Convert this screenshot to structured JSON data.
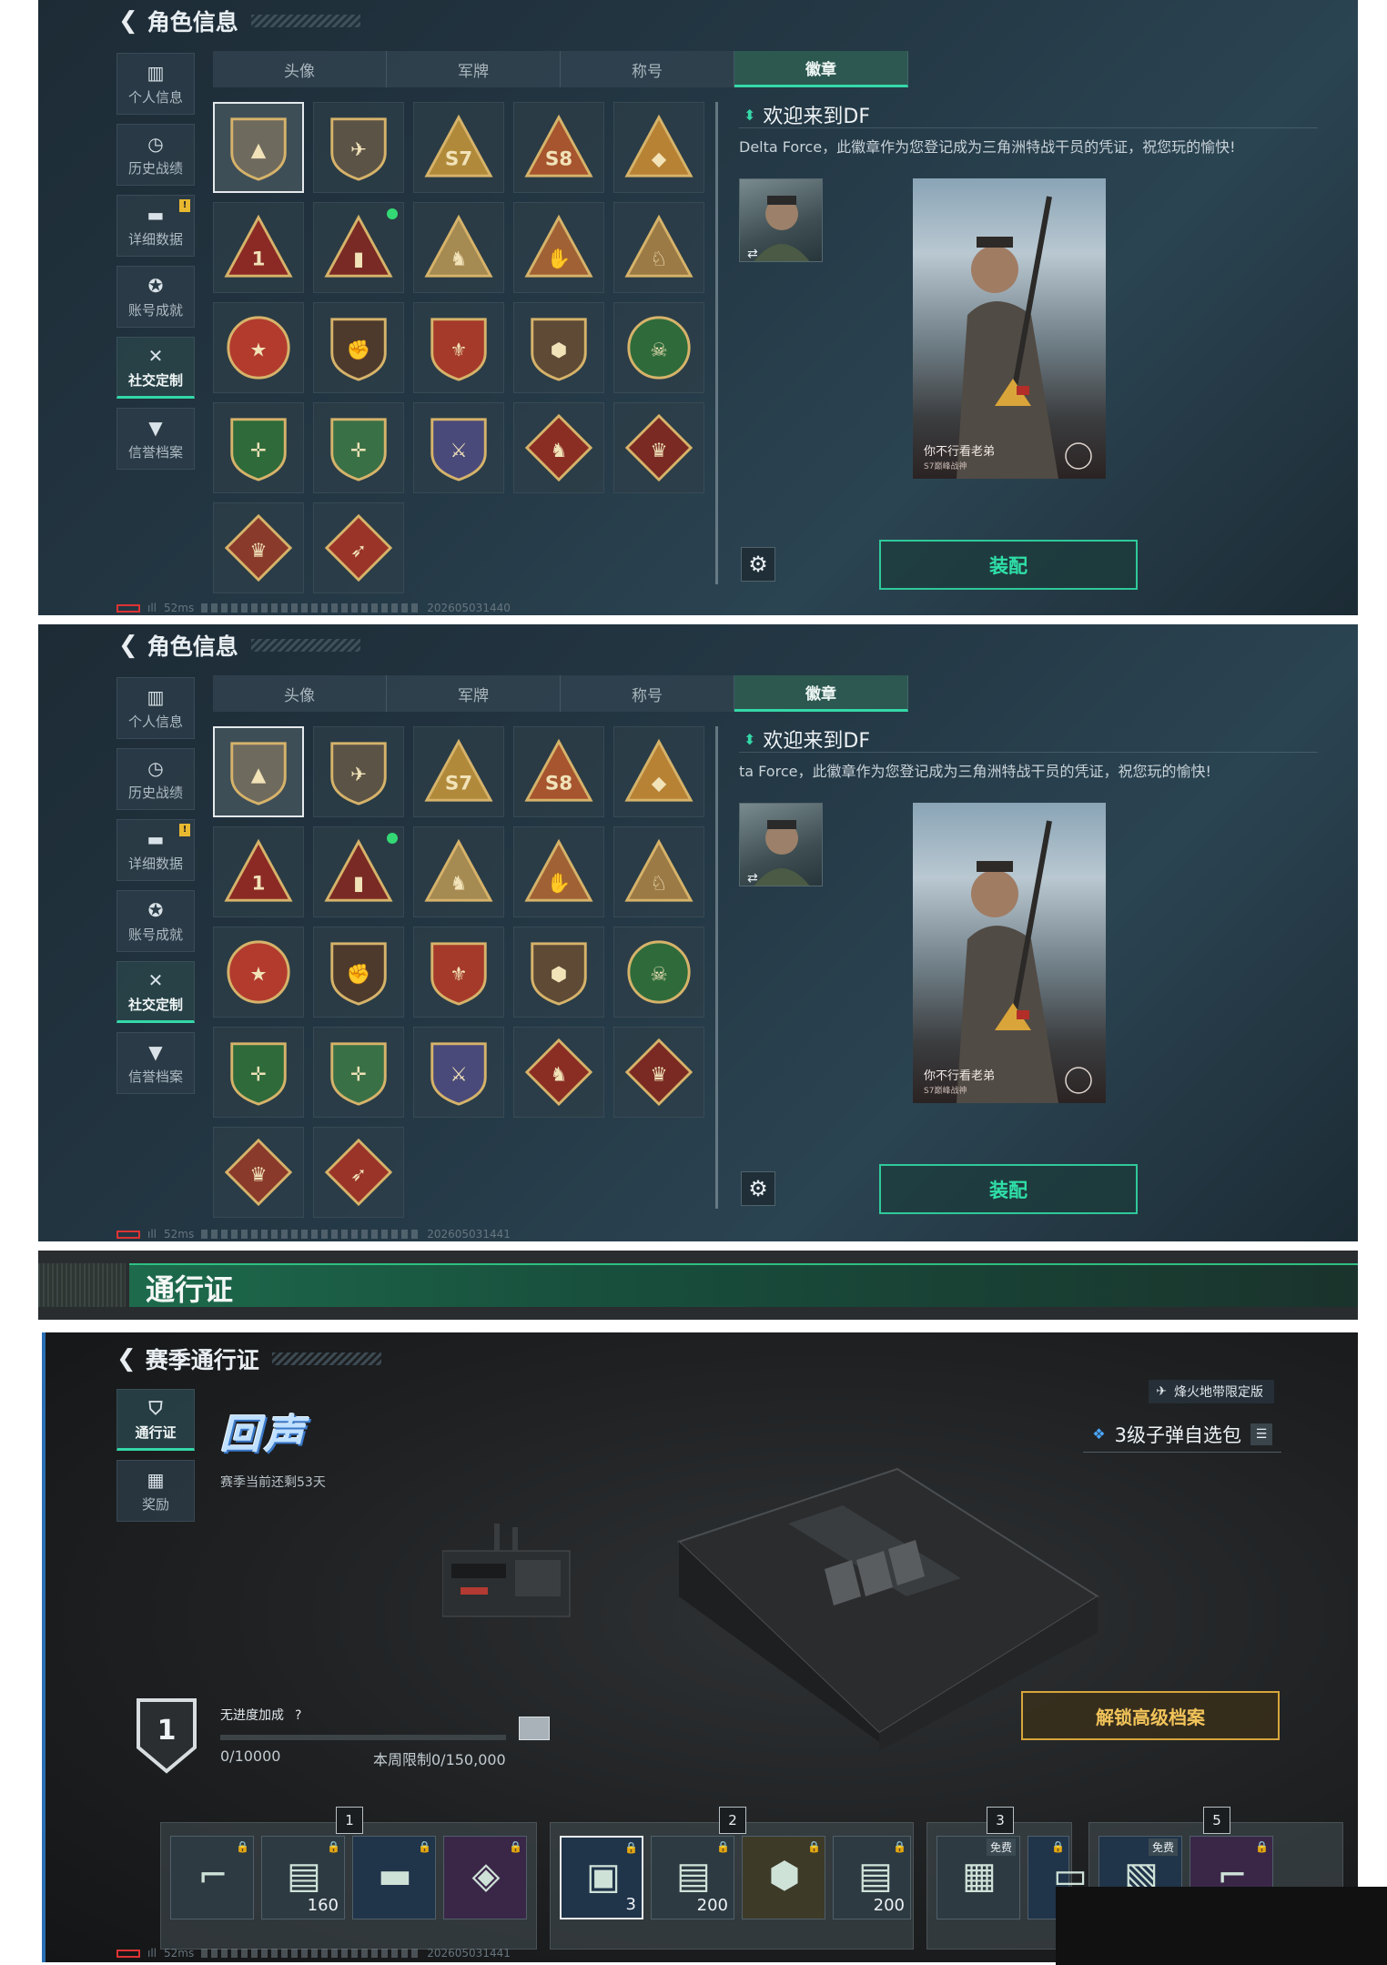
{
  "role_panels": [
    {
      "title": "角色信息",
      "sidebar": [
        {
          "label": "个人信息",
          "icon": "chart-icon"
        },
        {
          "label": "历史战绩",
          "icon": "clock-icon"
        },
        {
          "label": "详细数据",
          "icon": "folder-icon",
          "notice": "!"
        },
        {
          "label": "账号成就",
          "icon": "medal-icon"
        },
        {
          "label": "社交定制",
          "icon": "tools-icon",
          "active": true
        },
        {
          "label": "信誉档案",
          "icon": "shield-icon"
        }
      ],
      "tabs": [
        "头像",
        "军牌",
        "称号",
        "徽章"
      ],
      "active_tab": "徽章",
      "detail_title": "欢迎来到DF",
      "detail_desc": "Delta Force，此徽章作为您登记成为三角洲特战干员的凭证，祝您玩的愉快!",
      "card_name": "你不行看老弟",
      "card_sub": "S7巅峰战神",
      "equip_label": "装配",
      "status_ping": "52ms",
      "status_code": "202605031440"
    },
    {
      "title": "角色信息",
      "sidebar": [
        {
          "label": "个人信息",
          "icon": "chart-icon"
        },
        {
          "label": "历史战绩",
          "icon": "clock-icon"
        },
        {
          "label": "详细数据",
          "icon": "folder-icon",
          "notice": "!"
        },
        {
          "label": "账号成就",
          "icon": "medal-icon"
        },
        {
          "label": "社交定制",
          "icon": "tools-icon",
          "active": true
        },
        {
          "label": "信誉档案",
          "icon": "shield-icon"
        }
      ],
      "tabs": [
        "头像",
        "军牌",
        "称号",
        "徽章"
      ],
      "active_tab": "徽章",
      "detail_title": "欢迎来到DF",
      "detail_desc": "ta Force，此徽章作为您登记成为三角洲特战干员的凭证，祝您玩的愉快!",
      "card_name": "你不行看老弟",
      "card_sub": "S7巅峰战神",
      "equip_label": "装配",
      "status_ping": "52ms",
      "status_code": "202605031441"
    }
  ],
  "badges": [
    {
      "name": "delta-badge",
      "shape": "shield",
      "color": "#6f6a5e",
      "mark": "▲",
      "selected": true
    },
    {
      "name": "helicopter-badge",
      "shape": "shield",
      "color": "#5b5346",
      "mark": "✈"
    },
    {
      "name": "s7-badge",
      "shape": "triangle",
      "color": "#b08a3a",
      "mark": "S7"
    },
    {
      "name": "s8-badge",
      "shape": "triangle",
      "color": "#a6552e",
      "mark": "S8"
    },
    {
      "name": "wings-badge",
      "shape": "triangle",
      "color": "#b88234",
      "mark": "◆"
    },
    {
      "name": "rank1-badge",
      "shape": "triangle",
      "color": "#8b2a25",
      "mark": "1"
    },
    {
      "name": "crate-badge",
      "shape": "triangle",
      "color": "#7a2a24",
      "mark": "▮",
      "dot": true
    },
    {
      "name": "soldier-badge",
      "shape": "triangle",
      "color": "#a58a52",
      "mark": "♞"
    },
    {
      "name": "hand-badge",
      "shape": "triangle",
      "color": "#a06235",
      "mark": "✋"
    },
    {
      "name": "dog-badge",
      "shape": "triangle",
      "color": "#9c7a45",
      "mark": "♘"
    },
    {
      "name": "star-badge",
      "shape": "round",
      "color": "#b23b2e",
      "mark": "★"
    },
    {
      "name": "fist-badge",
      "shape": "shield",
      "color": "#4d3a2c",
      "mark": "✊"
    },
    {
      "name": "crest-badge",
      "shape": "shield",
      "color": "#a53a2a",
      "mark": "⚜"
    },
    {
      "name": "dice-badge",
      "shape": "shield",
      "color": "#5e4a35",
      "mark": "⬢"
    },
    {
      "name": "skull-badge",
      "shape": "round",
      "color": "#2f6b3a",
      "mark": "☠"
    },
    {
      "name": "rifle-green-badge",
      "shape": "shield",
      "color": "#2e6a3a",
      "mark": "✛"
    },
    {
      "name": "rifle-green2-badge",
      "shape": "shield",
      "color": "#3a7046",
      "mark": "✛"
    },
    {
      "name": "sword-badge",
      "shape": "shield",
      "color": "#4a4a7a",
      "mark": "⚔"
    },
    {
      "name": "wolf-badge",
      "shape": "diamond",
      "color": "#8a2e24",
      "mark": "♞"
    },
    {
      "name": "dragon-badge",
      "shape": "diamond",
      "color": "#7a2a22",
      "mark": "♛"
    },
    {
      "name": "dragon2-badge",
      "shape": "diamond",
      "color": "#8a3a2a",
      "mark": "♛"
    },
    {
      "name": "runner-badge",
      "shape": "diamond",
      "color": "#9a3428",
      "mark": "➶"
    }
  ],
  "banner": {
    "title": "通行证"
  },
  "pass": {
    "title": "赛季通行证",
    "sidebar": [
      {
        "label": "通行证",
        "icon": "pass-icon",
        "active": true
      },
      {
        "label": "奖励",
        "icon": "gift-icon"
      }
    ],
    "logo": "回声",
    "season_left": "赛季当前还剩53天",
    "limited": "烽火地带限定版",
    "pick_label": "3级子弹自选包",
    "level": "1",
    "no_progress": "无进度加成",
    "help": "?",
    "progress_text": "0/10000",
    "progress_fraction": 0,
    "weekly_limit": "本周限制0/150,000",
    "unlock_label": "解锁高级档案",
    "status_ping": "52ms",
    "status_code": "202605031441",
    "reward_groups": [
      {
        "num": "1",
        "items": [
          {
            "name": "rifle-reward",
            "tone": "",
            "count": ""
          },
          {
            "name": "cash-reward",
            "tone": "",
            "count": "160"
          },
          {
            "name": "case-reward",
            "tone": "blue",
            "count": ""
          },
          {
            "name": "vehicle-reward",
            "tone": "purple",
            "count": ""
          }
        ]
      },
      {
        "num": "2",
        "items": [
          {
            "name": "ammo-box-reward",
            "tone": "blue",
            "count": "3",
            "selected": true
          },
          {
            "name": "cash-reward-2",
            "tone": "",
            "count": "200"
          },
          {
            "name": "armor-reward",
            "tone": "gold",
            "count": ""
          },
          {
            "name": "cash-reward-3",
            "tone": "",
            "count": "200"
          }
        ]
      },
      {
        "num": "3",
        "items": [
          {
            "name": "vest-reward",
            "tone": "",
            "count": "",
            "tag": "免费"
          },
          {
            "name": "card-reward",
            "tone": "blue",
            "count": ""
          }
        ]
      },
      {
        "num": "5",
        "items": [
          {
            "name": "ticket-reward",
            "tone": "blue",
            "count": "",
            "tag": "免费"
          },
          {
            "name": "pink-rifle-reward",
            "tone": "purple",
            "count": ""
          }
        ]
      }
    ]
  }
}
